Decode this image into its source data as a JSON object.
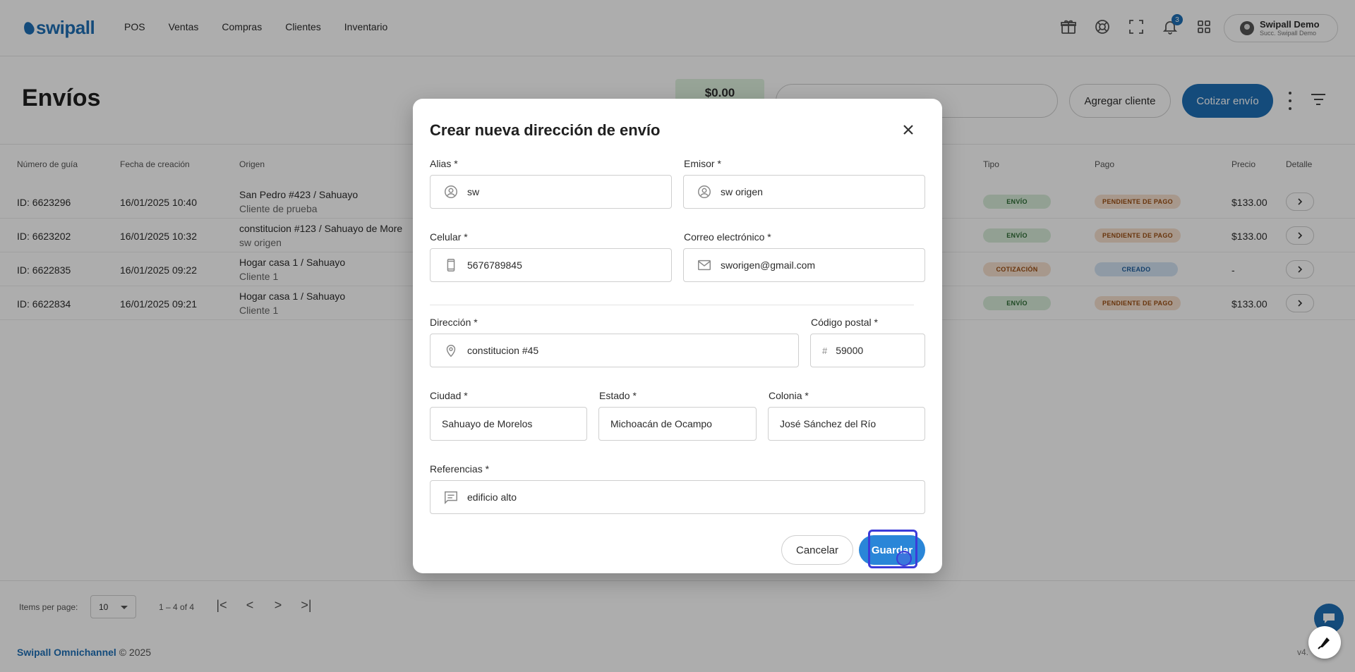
{
  "app": {
    "logo_text": "swipall"
  },
  "nav": {
    "items": [
      {
        "label": "POS"
      },
      {
        "label": "Ventas"
      },
      {
        "label": "Compras"
      },
      {
        "label": "Clientes"
      },
      {
        "label": "Inventario"
      }
    ],
    "notification_count": "3",
    "user_name": "Swipall Demo",
    "user_branch": "Succ. Swipall Demo"
  },
  "page": {
    "title": "Envíos",
    "balance": "$0.00",
    "add_client_label": "Agregar cliente",
    "quote_label": "Cotizar envío"
  },
  "table": {
    "headers": {
      "guia": "Número de guía",
      "fecha": "Fecha de creación",
      "origen": "Origen",
      "tipo": "Tipo",
      "pago": "Pago",
      "precio": "Precio",
      "detalle": "Detalle"
    },
    "rows": [
      {
        "guia": "ID: 6623296",
        "fecha": "16/01/2025 10:40",
        "origen": "San Pedro #423 / Sahuayo",
        "origen_sub": "Cliente de prueba",
        "tipo": "ENVÍO",
        "pago": "PENDIENTE DE PAGO",
        "precio": "$133.00"
      },
      {
        "guia": "ID: 6623202",
        "fecha": "16/01/2025 10:32",
        "origen": "constitucion #123 / Sahuayo de More",
        "origen_sub": "sw origen",
        "tipo": "ENVÍO",
        "pago": "PENDIENTE DE PAGO",
        "precio": "$133.00"
      },
      {
        "guia": "ID: 6622835",
        "fecha": "16/01/2025 09:22",
        "origen": "Hogar casa 1 / Sahuayo",
        "origen_sub": "Cliente 1",
        "tipo": "COTIZACIÓN",
        "pago": "CREADO",
        "precio": "-"
      },
      {
        "guia": "ID: 6622834",
        "fecha": "16/01/2025 09:21",
        "origen": "Hogar casa 1 / Sahuayo",
        "origen_sub": "Cliente 1",
        "tipo": "ENVÍO",
        "pago": "PENDIENTE DE PAGO",
        "precio": "$133.00"
      }
    ]
  },
  "paginator": {
    "label": "Items per page:",
    "page_size": "10",
    "range": "1 – 4 of 4",
    "first": "|<",
    "prev": "<",
    "next": ">",
    "last": ">|"
  },
  "footer": {
    "brand": "Swipall Omnichannel",
    "copyright": "© 2025",
    "version": "v4."
  },
  "modal": {
    "title": "Crear nueva dirección de envío",
    "fields": {
      "alias": {
        "label": "Alias *",
        "value": "sw"
      },
      "emisor": {
        "label": "Emisor *",
        "value": "sw origen"
      },
      "celular": {
        "label": "Celular *",
        "value": "5676789845"
      },
      "correo": {
        "label": "Correo electrónico *",
        "value": "sworigen@gmail.com"
      },
      "direccion": {
        "label": "Dirección *",
        "value": "constitucion #45"
      },
      "cp": {
        "label": "Código postal *",
        "value": "59000",
        "prefix": "#"
      },
      "ciudad": {
        "label": "Ciudad *",
        "value": "Sahuayo de Morelos"
      },
      "estado": {
        "label": "Estado *",
        "value": "Michoacán de Ocampo"
      },
      "colonia": {
        "label": "Colonia *",
        "value": "José Sánchez del Río"
      },
      "referencias": {
        "label": "Referencias *",
        "value": "edificio alto"
      }
    },
    "cancel_label": "Cancelar",
    "save_label": "Guardar"
  },
  "colors": {
    "primary": "#1e6fb5",
    "save_button": "#2a86d8",
    "tipo_envio_bg": "#d7ecd9",
    "pago_pendiente_bg": "#f7e1cf",
    "pago_creado_bg": "#d3e4f4",
    "focus_ring": "#3b3bd9"
  }
}
